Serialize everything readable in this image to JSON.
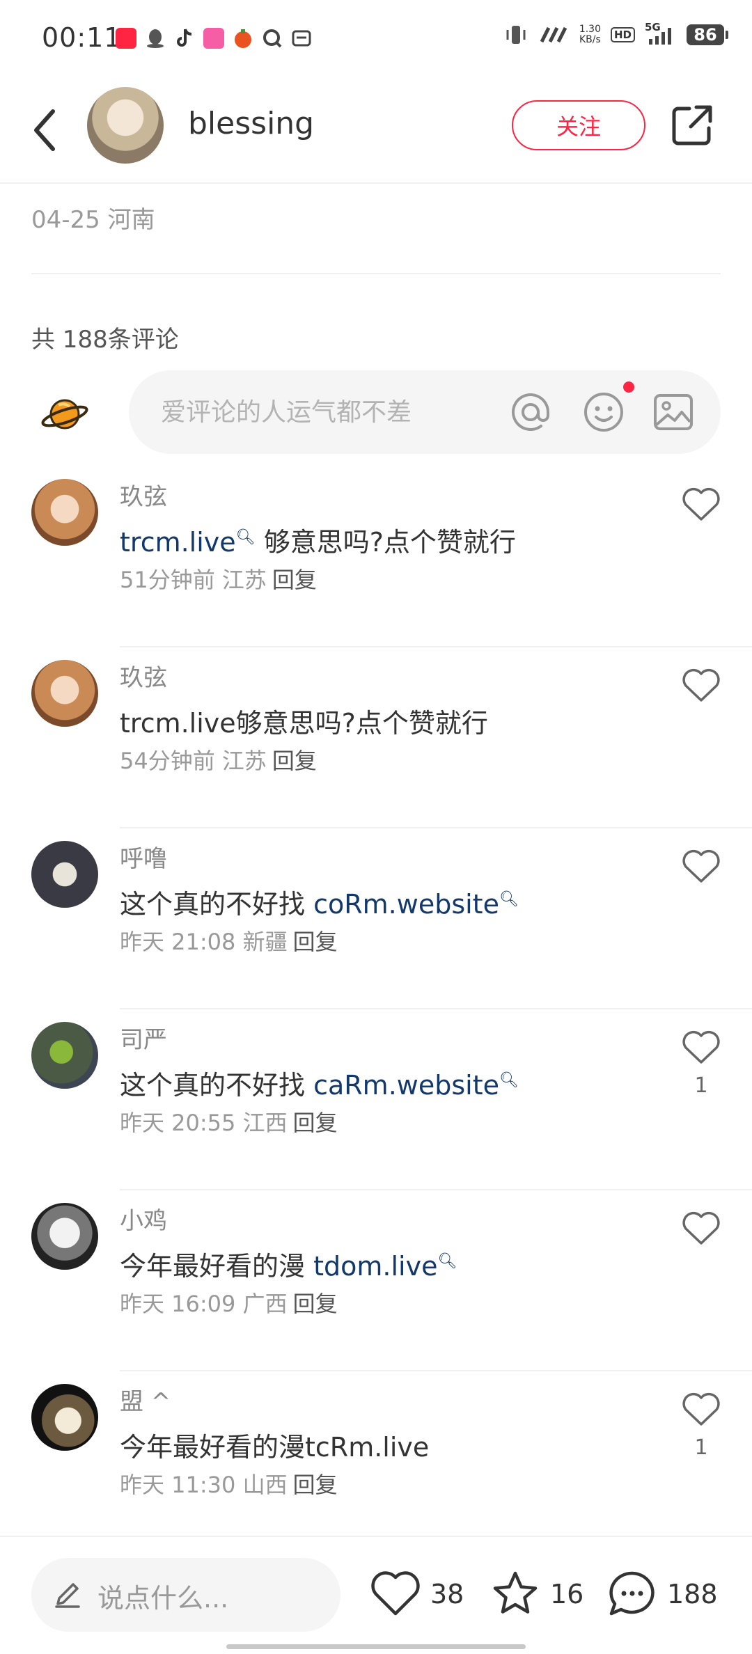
{
  "status_bar": {
    "time": "00:11",
    "network_speed": "1.30\nKB/s",
    "hd_label": "HD",
    "signal_label": "5G",
    "battery": "86"
  },
  "header": {
    "username": "blessing",
    "follow_label": "关注"
  },
  "post": {
    "date_location": "04-25 河南"
  },
  "comments_section": {
    "count_label": "共 188条评论",
    "input_placeholder": "爱评论的人运气都不差"
  },
  "comments": [
    {
      "name": "玖弦",
      "link": "trcm.live",
      "link_search_icon": true,
      "text_after": " 够意思吗?点个赞就行",
      "time": "51分钟前",
      "location": "江苏",
      "reply": "回复",
      "likes": ""
    },
    {
      "name": "玖弦",
      "text_plain": "trcm.live够意思吗?点个赞就行",
      "time": "54分钟前",
      "location": "江苏",
      "reply": "回复",
      "likes": ""
    },
    {
      "name": "呼噜",
      "text_before": "这个真的不好找 ",
      "link": "coRm.website",
      "link_search_icon": true,
      "time": "昨天 21:08",
      "location": "新疆",
      "reply": "回复",
      "likes": ""
    },
    {
      "name": "司严",
      "text_before": "这个真的不好找 ",
      "link": "caRm.website",
      "link_search_icon": true,
      "time": "昨天 20:55",
      "location": "江西",
      "reply": "回复",
      "likes": "1"
    },
    {
      "name": "小鸡",
      "text_before": "今年最好看的漫 ",
      "link": "tdom.live",
      "link_search_icon": true,
      "time": "昨天 16:09",
      "location": "广西",
      "reply": "回复",
      "likes": ""
    },
    {
      "name": "盟 ^",
      "text_plain": "今年最好看的漫tcRm.live",
      "time": "昨天 11:30",
      "location": "山西",
      "reply": "回复",
      "likes": "1"
    }
  ],
  "bottom_bar": {
    "placeholder": "说点什么...",
    "like_count": "38",
    "star_count": "16",
    "comment_count": "188"
  },
  "colors": {
    "accent": "#ff2442",
    "link": "#13386c",
    "muted": "#999999"
  }
}
